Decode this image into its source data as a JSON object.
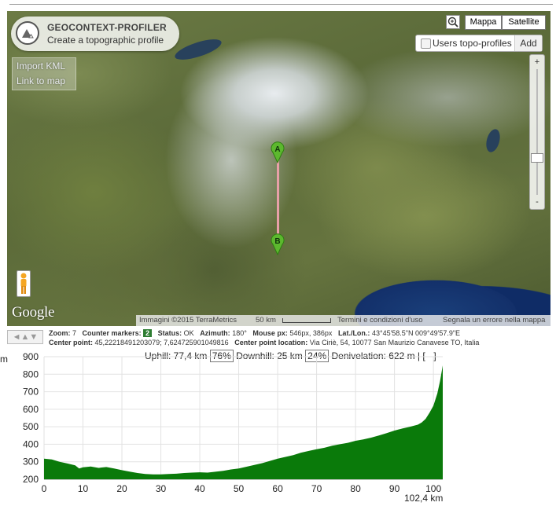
{
  "logo": {
    "title": "GEOCONTEXT-PROFILER",
    "subtitle": "Create a topographic profile"
  },
  "kml_menu": {
    "import": "Import KML",
    "link": "Link to map"
  },
  "map_types": {
    "mappa": "Mappa",
    "satellite": "Satellite"
  },
  "users_profiles": {
    "label": "Users topo-profiles",
    "add": "Add"
  },
  "zoom_slider": {
    "plus": "+",
    "minus": "-"
  },
  "markers": {
    "a": "A",
    "b": "B"
  },
  "google": "Google",
  "attribution": {
    "imagery": "Immagini ©2015 TerraMetrics",
    "scale": "50 km",
    "terms": "Termini e condizioni d'uso",
    "report": "Segnala un errore nella mappa"
  },
  "nav": {
    "arrows": "◄▲▼"
  },
  "info": {
    "zoom_label": "Zoom:",
    "zoom_value": "7",
    "counter_label": "Counter markers:",
    "counter_value": "2",
    "status_label": "Status:",
    "status_value": "OK",
    "azimuth_label": "Azimuth:",
    "azimuth_value": "180°",
    "mouse_label": "Mouse px:",
    "mouse_value": "546px, 386px",
    "latlon_label": "Lat./Lon.:",
    "latlon_value": "43°45'58.5\"N 009°49'57.9\"E",
    "center_label": "Center point:",
    "center_value": "45,22218491203079; 7,624725901049816",
    "center_loc_label": "Center point location:",
    "center_loc_value": "Via Ciriè, 54, 10077 San Maurizio Canavese TO, Italia"
  },
  "profile": {
    "uphill_label": "Uphill: 77,4 km",
    "uphill_pct": "76%",
    "downhill_label": "Downhill: 25 km",
    "downhill_pct": "24%",
    "deniv_label": "Denivelation: 622 m | [ - ]",
    "y_unit": "m",
    "total_distance": "102,4 km"
  },
  "colors": {
    "profile_fill": "#0a7a0a",
    "marker": "#5cb82e",
    "route": "#e8a0a8"
  },
  "chart_data": {
    "type": "area",
    "title": "",
    "xlabel": "",
    "ylabel": "m",
    "xlim": [
      0,
      102.4
    ],
    "ylim": [
      200,
      900
    ],
    "x_ticks": [
      0,
      10,
      20,
      30,
      40,
      50,
      60,
      70,
      80,
      90,
      100
    ],
    "y_ticks": [
      200,
      300,
      400,
      500,
      600,
      700,
      800,
      900
    ],
    "grid": true,
    "series": [
      {
        "x": [
          0,
          2,
          4,
          6,
          8,
          9,
          10,
          12,
          14,
          16,
          18,
          20,
          22,
          24,
          26,
          28,
          30,
          32,
          34,
          36,
          38,
          40,
          42,
          44,
          46,
          48,
          50,
          52,
          54,
          56,
          58,
          60,
          62,
          64,
          66,
          68,
          70,
          72,
          74,
          76,
          78,
          80,
          82,
          84,
          86,
          88,
          90,
          92,
          94,
          96,
          97,
          98,
          99,
          100,
          101,
          101.7,
          102.4
        ],
        "y": [
          318,
          313,
          300,
          290,
          280,
          262,
          268,
          273,
          265,
          270,
          262,
          252,
          244,
          236,
          230,
          228,
          228,
          230,
          232,
          236,
          238,
          240,
          238,
          243,
          248,
          256,
          262,
          272,
          282,
          292,
          305,
          318,
          328,
          338,
          352,
          362,
          372,
          380,
          392,
          400,
          408,
          420,
          428,
          438,
          450,
          464,
          478,
          490,
          500,
          512,
          525,
          545,
          580,
          620,
          690,
          760,
          850
        ]
      }
    ]
  }
}
